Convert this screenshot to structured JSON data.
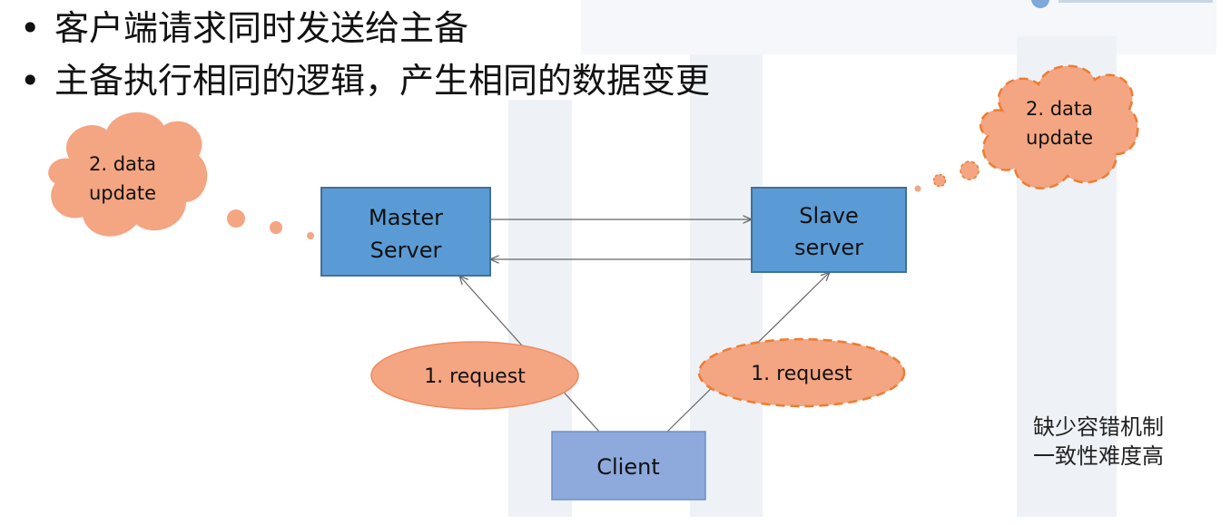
{
  "bullets": [
    "客户端请求同时发送给主备",
    "主备执行相同的逻辑，产生相同的数据变更"
  ],
  "diagram": {
    "master_label": [
      "Master",
      "Server"
    ],
    "slave_label": [
      "Slave",
      "server"
    ],
    "client_label": "Client",
    "request_left": "1. request",
    "request_right": "1. request",
    "update_left": [
      "2. data",
      "update"
    ],
    "update_right": [
      "2. data",
      "update"
    ]
  },
  "note": [
    "缺少容错机制",
    "一致性难度高"
  ],
  "colors": {
    "server_fill": "#5b9bd5",
    "server_stroke": "#41719c",
    "client_fill": "#8ea9db",
    "blob_fill": "#f4a582",
    "blob_stroke": "#ed7d31"
  }
}
